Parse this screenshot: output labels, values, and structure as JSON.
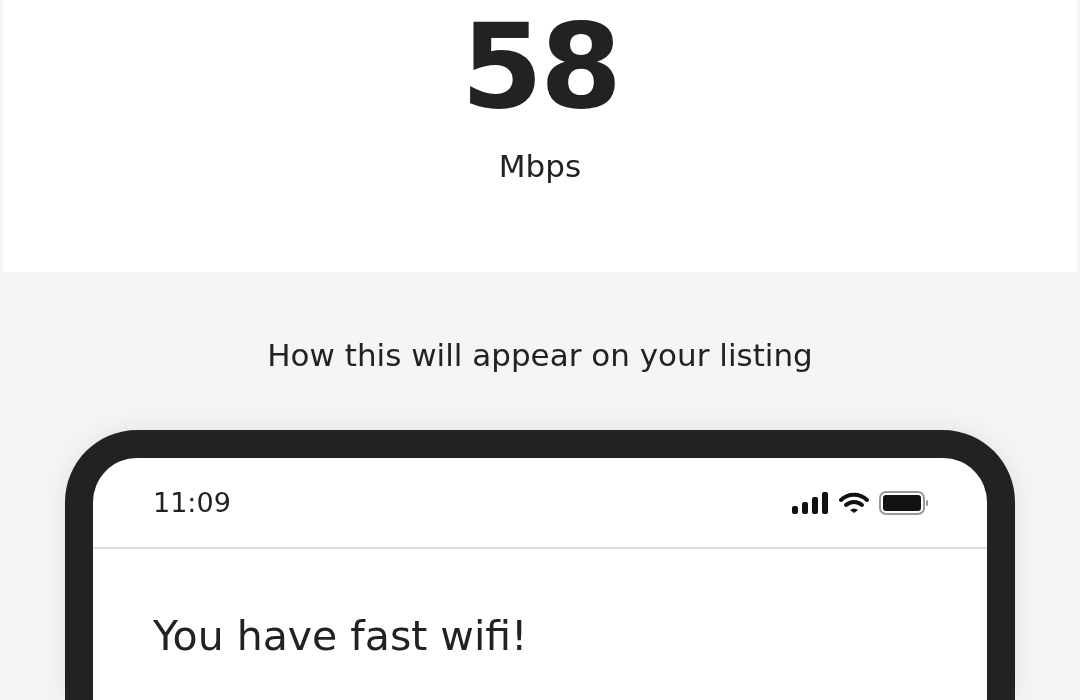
{
  "speed": {
    "value": "58",
    "unit": "Mbps"
  },
  "preview": {
    "heading": "How this will appear on your listing",
    "phone": {
      "status_bar": {
        "time": "11:09"
      },
      "title": "You have fast wifi!"
    }
  }
}
